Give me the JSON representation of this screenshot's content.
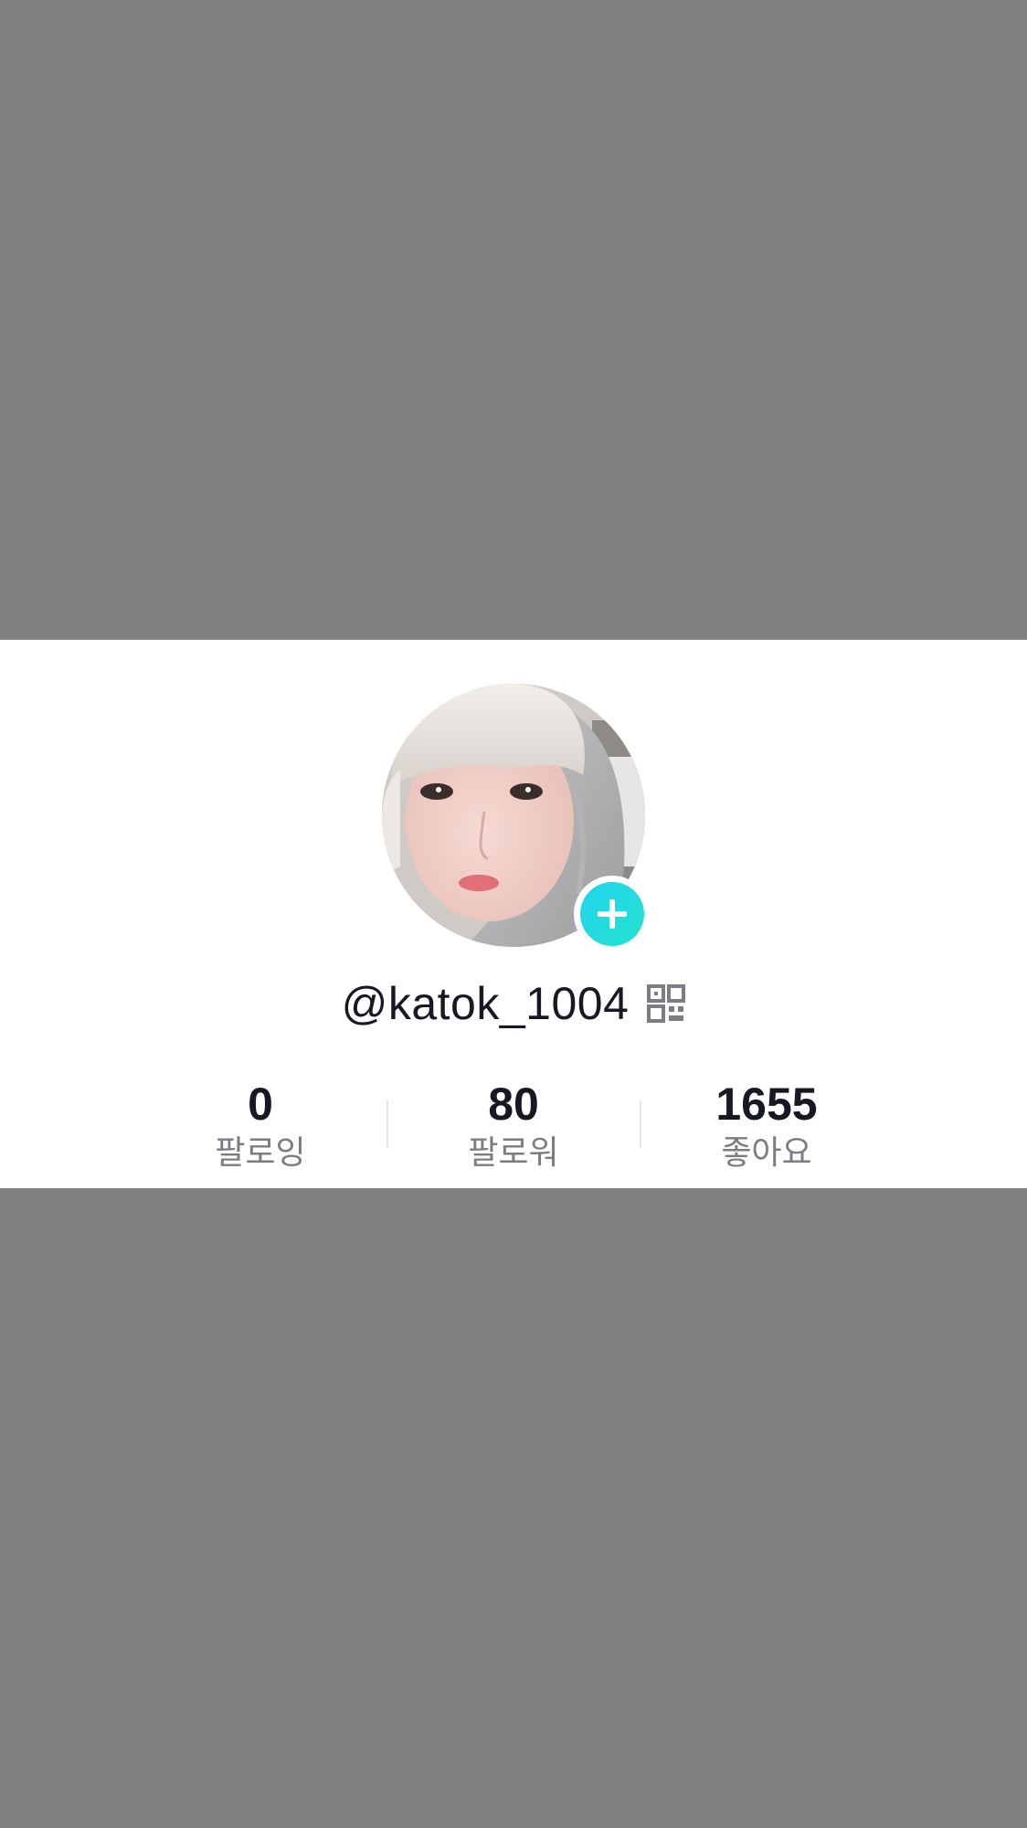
{
  "profile": {
    "username": "@katok_1004",
    "avatar_alt": "profile photo",
    "add_icon": "plus-icon",
    "qr_icon": "qr-code-icon"
  },
  "stats": [
    {
      "value": "0",
      "label": "팔로잉"
    },
    {
      "value": "80",
      "label": "팔로워"
    },
    {
      "value": "1655",
      "label": "좋아요"
    }
  ],
  "colors": {
    "background_dim": "#808080",
    "card": "#ffffff",
    "accent": "#20d5ec",
    "text_primary": "#161823",
    "text_secondary": "#7c7d82"
  }
}
